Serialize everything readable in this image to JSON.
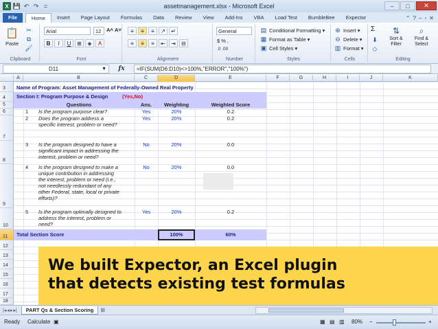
{
  "window": {
    "title": "assetmanagement.xlsx - Microsoft Excel",
    "controls": {
      "min": "–",
      "max": "□",
      "close": "✕"
    }
  },
  "qat": {
    "logo": "X",
    "save": "💾",
    "undo": "↶",
    "redo": "↷",
    "more": "="
  },
  "ribbon_tabs": [
    "File",
    "Home",
    "Insert",
    "Page Layout",
    "Formulas",
    "Data",
    "Review",
    "View",
    "Add-Ins",
    "VBA",
    "Load Test",
    "BumbleBee",
    "Expector"
  ],
  "ribbon": {
    "clipboard": {
      "paste": "Paste",
      "label": "Clipboard"
    },
    "font": {
      "name": "Arial",
      "size": "12",
      "bold": "B",
      "italic": "I",
      "underline": "U",
      "grow": "A˄",
      "shrink": "A˅",
      "label": "Font"
    },
    "alignment": {
      "label": "Alignment"
    },
    "number": {
      "format": "General",
      "currency": "$",
      "percent": "%",
      "comma": ",",
      "inc_dec": ".0 .00",
      "label": "Number"
    },
    "styles": {
      "conditional": "Conditional Formatting",
      "table": "Format as Table",
      "cell_styles": "Cell Styles",
      "label": "Styles"
    },
    "cells": {
      "insert": "Insert",
      "delete": "Delete",
      "format": "Format",
      "label": "Cells"
    },
    "editing": {
      "sigma": "Σ",
      "sort": "Sort & Filter",
      "find": "Find & Select",
      "label": "Editing"
    }
  },
  "formula_bar": {
    "name_box": "D11",
    "fx": "fx",
    "formula": "=IF(SUM(D6:D10)<>100%,\"ERROR\",\"100%\")"
  },
  "columns": [
    "A",
    "B",
    "C",
    "D",
    "E",
    "F",
    "G",
    "H",
    "I",
    "J",
    "K"
  ],
  "rows": [
    "3",
    "4",
    "5",
    "6",
    "7",
    "8",
    "9",
    "10",
    "11",
    "12",
    "13",
    "14",
    "15",
    "16",
    "17",
    "18"
  ],
  "sheet": {
    "program_label": "Name of Program:  Asset Management of Federally-Owned Real Property",
    "section_title": "Section I:  Program Purpose & Design",
    "section_tag": "(Yes,No)",
    "headers": {
      "questions": "Questions",
      "ans": "Ans.",
      "weighting": "Weighting",
      "weighted_score": "Weighted Score"
    },
    "questions": [
      {
        "num": "1",
        "text": [
          "Is the program purpose clear?"
        ],
        "ans": "Yes",
        "weight": "20%",
        "score": "0.2"
      },
      {
        "num": "2",
        "text": [
          "Does the program address a",
          "specific interest, problem or need?"
        ],
        "ans": "Yes",
        "weight": "20%",
        "score": "0.2"
      },
      {
        "num": "3",
        "text": [
          "Is the program designed to have a",
          "significant impact in addressing the",
          "interest, problem or need?"
        ],
        "ans": "No",
        "weight": "20%",
        "score": "0.0"
      },
      {
        "num": "4",
        "text": [
          "Is the program designed to make a",
          "unique contribution in addressing",
          "the interest, problem or need (i.e.,",
          "not needlessly redundant of any",
          "other Federal, state, local or private",
          "efforts)?"
        ],
        "ans": "No",
        "weight": "20%",
        "score": "0.0"
      },
      {
        "num": "5",
        "text": [
          "Is the program optimally designed to",
          "address the interest, problem or",
          "need?"
        ],
        "ans": "Yes",
        "weight": "20%",
        "score": "0.2"
      }
    ],
    "total_label": "Total Section Score",
    "total_weight": "100%",
    "total_score": "60%"
  },
  "banner": {
    "line1": "We built Expector, an Excel plugin",
    "line2": "that detects existing test formulas"
  },
  "sheet_tabs": {
    "nav": [
      "|◂",
      "◂",
      "▸",
      "▸|"
    ],
    "active": "PART Qs & Section Scoring"
  },
  "status": {
    "ready": "Ready",
    "calculate": "Calculate",
    "zoom": "80%",
    "minus": "−",
    "plus": "+"
  },
  "colors": {
    "band": "#ccccff",
    "navy": "#1a237e",
    "blue": "#1a35c9",
    "red": "#d0102a",
    "banner": "#fdd240"
  }
}
